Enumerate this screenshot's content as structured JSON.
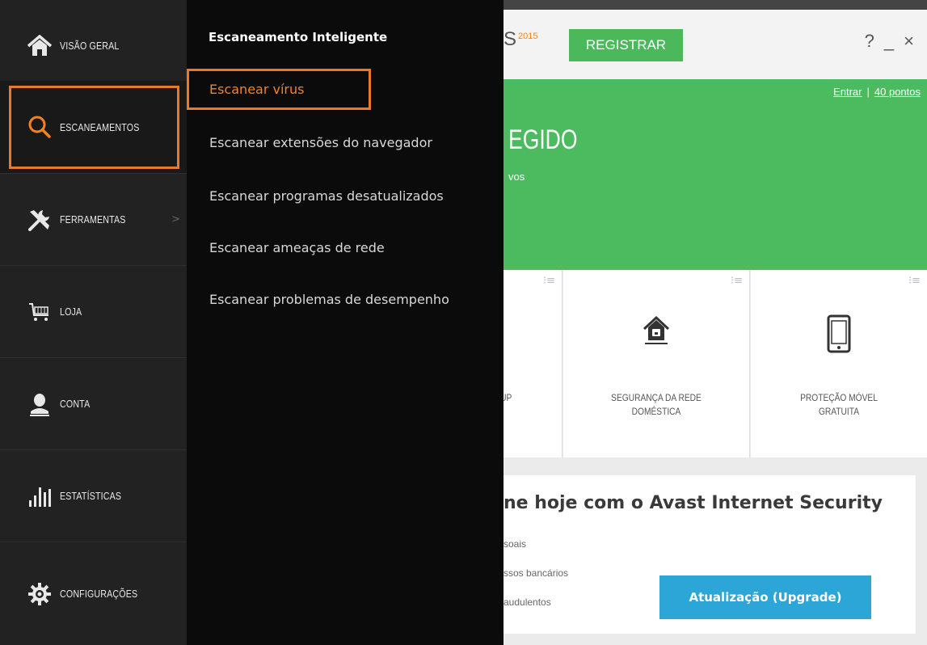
{
  "titlebar": {
    "brand_suffix": "S",
    "brand_year": "2015",
    "register_label": "REGISTRAR",
    "help": "?",
    "minimize": "_",
    "close": "×"
  },
  "status": {
    "login_link": "Entrar",
    "points_link": "40 pontos",
    "title_partial": "EGIDO",
    "subtitle_partial": "vos"
  },
  "tiles": [
    {
      "label_line1": "UP",
      "label_line2": ""
    },
    {
      "label_line1": "SEGURANÇA DA REDE",
      "label_line2": "DOMÉSTICA"
    },
    {
      "label_line1": "PROTEÇÃO MÓVEL",
      "label_line2": "GRATUITA"
    }
  ],
  "promo": {
    "title_partial": "ne hoje com o Avast Internet Security",
    "line1": "soais",
    "line2": "ssos bancários",
    "line3": "audulentos",
    "upgrade_label": "Atualização (Upgrade)"
  },
  "submenu": {
    "title": "Escaneamento Inteligente",
    "items": [
      {
        "label": "Escanear vírus",
        "active": true
      },
      {
        "label": "Escanear extensões do navegador"
      },
      {
        "label": "Escanear programas desatualizados"
      },
      {
        "label": "Escanear ameaças de rede"
      },
      {
        "label": "Escanear problemas de desempenho"
      }
    ]
  },
  "sidebar": {
    "items": [
      {
        "label": "VISÃO GERAL",
        "icon": "home-icon"
      },
      {
        "label": "ESCANEAMENTOS",
        "icon": "magnifier-icon",
        "active": true
      },
      {
        "label": "FERRAMENTAS",
        "icon": "tools-icon",
        "chevron": ">"
      },
      {
        "label": "LOJA",
        "icon": "cart-icon"
      },
      {
        "label": "CONTA",
        "icon": "user-icon"
      },
      {
        "label": "ESTATÍSTICAS",
        "icon": "stats-icon"
      },
      {
        "label": "CONFIGURAÇÕES",
        "icon": "gear-icon"
      }
    ]
  },
  "colors": {
    "accent": "#f58220",
    "green": "#4cbb60",
    "upgrade_blue": "#2ba6d6",
    "sidebar_bg": "#222222",
    "submenu_bg": "#0b0b0b"
  }
}
